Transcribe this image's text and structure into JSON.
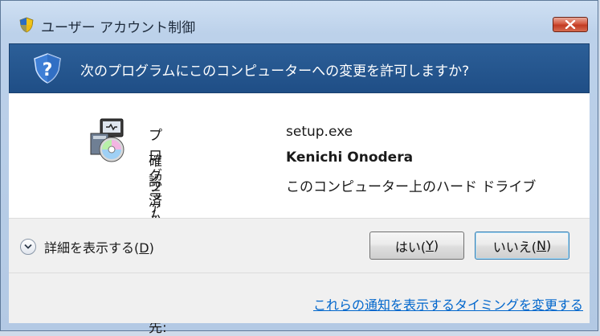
{
  "window": {
    "title": "ユーザー アカウント制御",
    "title_icon": "uac-shield-icon",
    "close_icon": "close-icon"
  },
  "header": {
    "question": "次のプログラムにこのコンピューターへの変更を許可しますか?",
    "icon": "question-shield-icon"
  },
  "program": {
    "icon": "setup-program-icon",
    "rows": [
      {
        "label": "プログラム名:",
        "value": "setup.exe"
      },
      {
        "label": "確認済みの発行元:",
        "value": "Kenichi Onodera"
      },
      {
        "label": "ファイルの入手先:",
        "value": "このコンピューター上のハード ドライブ"
      }
    ]
  },
  "details": {
    "text": "詳細を表示する(",
    "accel": "D",
    "close": ")"
  },
  "buttons": {
    "yes": {
      "text": "はい(",
      "accel": "Y",
      "close": ")"
    },
    "no": {
      "text": "いいえ(",
      "accel": "N",
      "close": ")"
    }
  },
  "footer": {
    "link": "これらの通知を表示するタイミングを変更する"
  },
  "colors": {
    "header_band": "#1f4e86",
    "link": "#0066cc",
    "close_button": "#c23b22"
  }
}
